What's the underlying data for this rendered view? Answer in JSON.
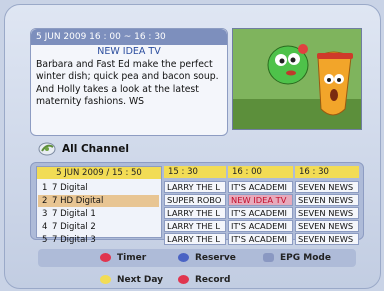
{
  "info": {
    "header": "5 JUN 2009  16 : 00 ~ 16 : 30",
    "title": "NEW IDEA TV",
    "description": "Barbara and Fast Ed make the perfect winter dish; quick pea and bacon soup. And Holly takes a look at the latest maternity fashions. WS"
  },
  "group": {
    "label": "All Channel",
    "icon": "satellite-dish-icon"
  },
  "guide": {
    "date_time": "5 JUN 2009 / 15 : 50",
    "times": [
      "15 : 30",
      "16 : 00",
      "16 : 30"
    ],
    "channels": [
      {
        "num": "1",
        "name": "7 Digital",
        "programs": [
          "LARRY THE L",
          "IT'S ACADEMI",
          "SEVEN NEWS"
        ]
      },
      {
        "num": "2",
        "name": "7 HD Digital",
        "programs": [
          "SUPER ROBO",
          "NEW IDEA TV",
          "SEVEN NEWS"
        ]
      },
      {
        "num": "3",
        "name": "7 Digital 1",
        "programs": [
          "LARRY THE L",
          "IT'S ACADEMI",
          "SEVEN NEWS"
        ]
      },
      {
        "num": "4",
        "name": "7 Digital 2",
        "programs": [
          "LARRY THE L",
          "IT'S ACADEMI",
          "SEVEN NEWS"
        ]
      },
      {
        "num": "5",
        "name": "7 Digital 3",
        "programs": [
          "LARRY THE L",
          "IT'S ACADEMI",
          "SEVEN NEWS"
        ]
      }
    ]
  },
  "legend": {
    "timer": "Timer",
    "reserve": "Reserve",
    "epg_mode": "EPG Mode",
    "next_day": "Next Day",
    "record": "Record"
  },
  "colors": {
    "red": "#e0354f",
    "blue": "#4a63c4",
    "yellow": "#f2dc55",
    "highlight": "#e7a9bb"
  }
}
